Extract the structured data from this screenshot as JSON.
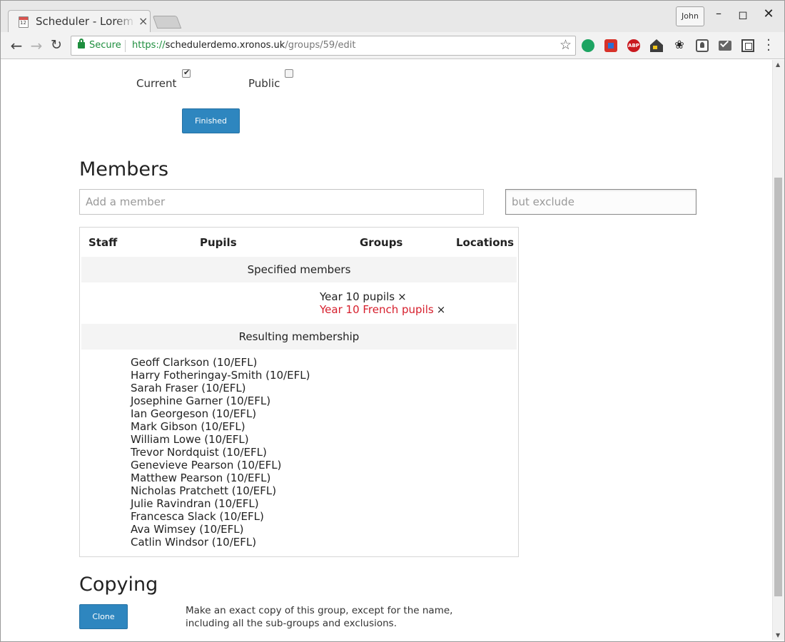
{
  "browser": {
    "tab_title": "Scheduler - Lorem Ipsum",
    "tab_close": "×",
    "profile_name": "John",
    "secure_label": "Secure",
    "url_scheme": "https://",
    "url_host": "schedulerdemo.xronos.uk",
    "url_path": "/groups/59/edit"
  },
  "form": {
    "current_label": "Current",
    "current_checked": true,
    "public_label": "Public",
    "public_checked": false,
    "finished_button": "Finished"
  },
  "members": {
    "heading": "Members",
    "add_placeholder": "Add a member",
    "exclude_placeholder": "but exclude",
    "columns": [
      "Staff",
      "Pupils",
      "Groups",
      "Locations"
    ],
    "specified_heading": "Specified members",
    "specified_groups": [
      {
        "name": "Year 10 pupils",
        "remove": "×",
        "excluded": false
      },
      {
        "name": "Year 10 French pupils",
        "remove": "×",
        "excluded": true
      }
    ],
    "resulting_heading": "Resulting membership",
    "resulting_pupils": [
      "Geoff Clarkson (10/EFL)",
      "Harry Fotheringay-Smith (10/EFL)",
      "Sarah Fraser (10/EFL)",
      "Josephine Garner (10/EFL)",
      "Ian Georgeson (10/EFL)",
      "Mark Gibson (10/EFL)",
      "William Lowe (10/EFL)",
      "Trevor Nordquist (10/EFL)",
      "Genevieve Pearson (10/EFL)",
      "Matthew Pearson (10/EFL)",
      "Nicholas Pratchett (10/EFL)",
      "Julie Ravindran (10/EFL)",
      "Francesca Slack (10/EFL)",
      "Ava Wimsey (10/EFL)",
      "Catlin Windsor (10/EFL)"
    ]
  },
  "copying": {
    "heading": "Copying",
    "clone_button": "Clone",
    "description": "Make an exact copy of this group, except for the name, including all the sub-groups and exclusions."
  },
  "colors": {
    "button_blue": "#2e86bf",
    "excluded_red": "#d61e2c",
    "secure_green": "#1e8e3e"
  }
}
